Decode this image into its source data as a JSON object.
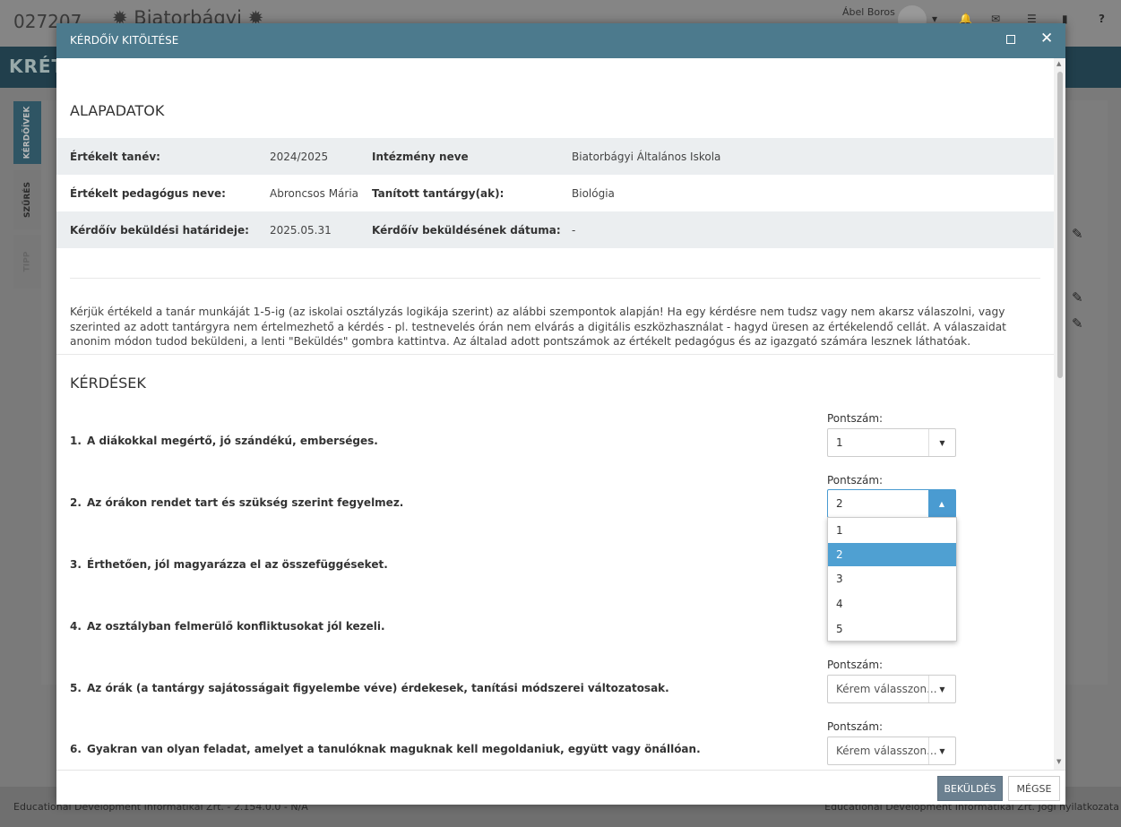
{
  "background": {
    "code": "027207",
    "school_short": "Biatorbágyi",
    "user": "Ábel Boros",
    "logo": "KRÉTA",
    "sidebar_tabs": [
      "KÉRDŐÍVEK",
      "SZŰRÉS",
      "TIPP"
    ],
    "footer_left": "Educational Development Informatikai Zrt. - 2.154.0.0 - N/A",
    "footer_right": "Educational Development Informatikai Zrt. Jogi nyilatkozata"
  },
  "modal": {
    "title": "KÉRDŐÍV KITÖLTÉSE",
    "basic": {
      "heading": "ALAPADATOK",
      "rows": [
        {
          "l1": "Értékelt tanév:",
          "v1": "2024/2025",
          "l2": "Intézmény neve",
          "v2": "Biatorbágyi Általános Iskola"
        },
        {
          "l1": "Értékelt pedagógus neve:",
          "v1": "Abroncsos Mária",
          "l2": "Tanított tantárgy(ak):",
          "v2": "Biológia"
        },
        {
          "l1": "Kérdőív beküldési határideje:",
          "v1": "2025.05.31",
          "l2": "Kérdőív beküldésének dátuma:",
          "v2": "-"
        }
      ]
    },
    "intro": "Kérjük értékeld a tanár munkáját 1-5-ig (az iskolai osztályzás logikája szerint) az alábbi szempontok alapján! Ha egy kérdésre nem tudsz vagy nem akarsz válaszolni, vagy szerinted az adott tantárgyra nem értelmezhető a kérdés - pl. testnevelés órán nem elvárás a digitális eszközhasználat - hagyd üresen az értékelendő cellát. A válaszaidat anonim módon tudod beküldeni, a lenti \"Beküldés\" gombra kattintva. Az általad adott pontszámok az értékelt pedagógus és az igazgató számára lesznek láthatóak.",
    "questions_heading": "KÉRDÉSEK",
    "score_label": "Pontszám:",
    "placeholder": "Kérem válasszon...",
    "questions": [
      {
        "num": "1.",
        "text": "A diákokkal megértő, jó szándékú, emberséges.",
        "value": "1"
      },
      {
        "num": "2.",
        "text": "Az órákon rendet tart és szükség szerint fegyelmez.",
        "value": "2"
      },
      {
        "num": "3.",
        "text": "Érthetően, jól magyarázza el az összefüggéseket.",
        "value": ""
      },
      {
        "num": "4.",
        "text": "Az osztályban felmerülő konfliktusokat jól kezeli.",
        "value": ""
      },
      {
        "num": "5.",
        "text": "Az órák (a tantárgy sajátosságait figyelembe véve) érdekesek, tanítási módszerei változatosak.",
        "value": "Kérem válasszon..."
      },
      {
        "num": "6.",
        "text": "Gyakran van olyan feladat, amelyet a tanulóknak maguknak kell megoldaniuk, együtt vagy önállóan.",
        "value": "Kérem válasszon..."
      }
    ],
    "dropdown_options": [
      "1",
      "2",
      "3",
      "4",
      "5"
    ],
    "dropdown_selected": "2",
    "send_label": "BEKÜLDÉS",
    "cancel_label": "MÉGSE"
  }
}
